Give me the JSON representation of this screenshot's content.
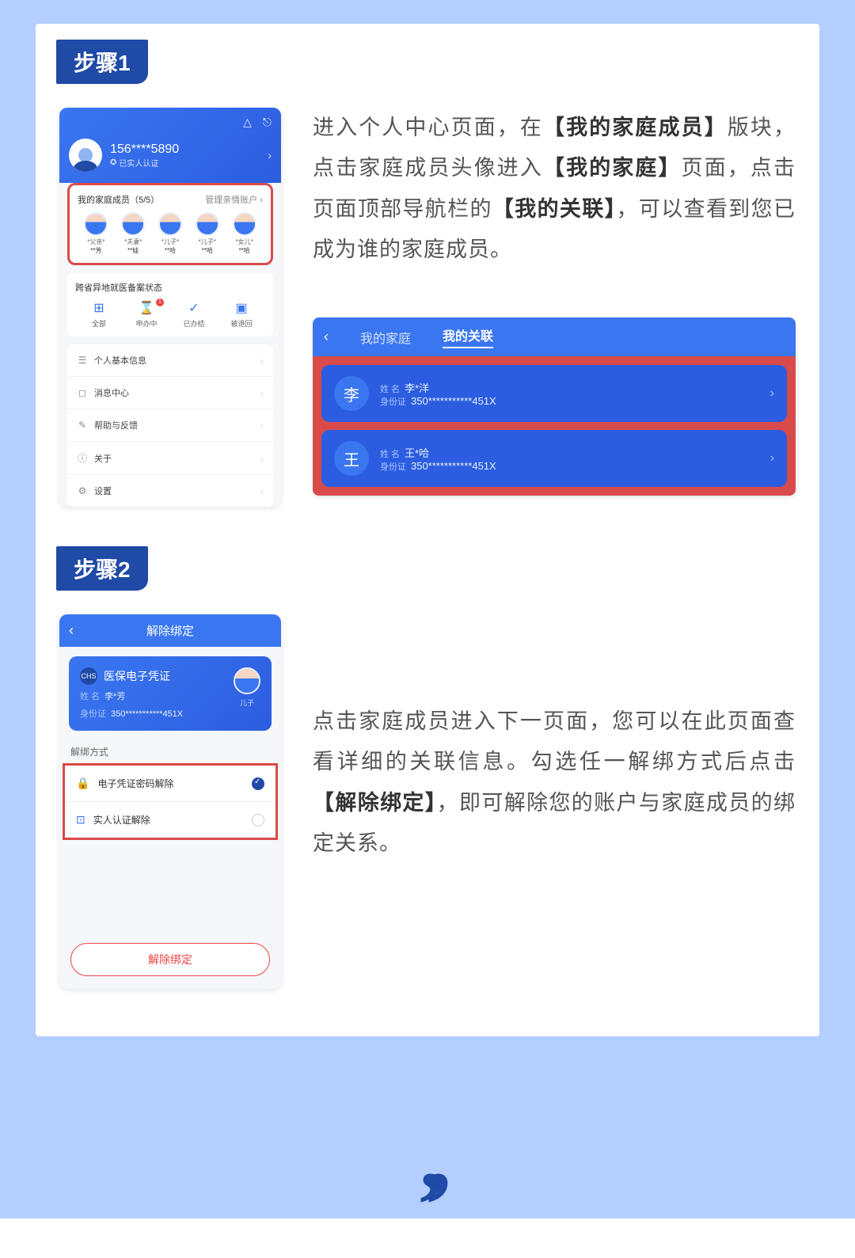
{
  "step1": {
    "badge": "步骤1",
    "desc_parts": {
      "p1": "进入个人中心页面，在",
      "b1": "【我的家庭成员】",
      "p2": "版块，点击家庭成员头像进入",
      "b2": "【我的家庭】",
      "p3": "页面，点击页面顶部导航栏的",
      "b3": "【我的关联】",
      "p4": "，可以查看到您已成为谁的家庭成员。"
    },
    "phone": {
      "user_name": "156****5890",
      "user_badge": "已实人认证",
      "family_title": "我的家庭成员（5/5）",
      "manage_label": "管理亲情账户",
      "members": [
        {
          "rel": "*父亲*",
          "name": "**芳"
        },
        {
          "rel": "*夫妻*",
          "name": "**娃"
        },
        {
          "rel": "*儿子*",
          "name": "**哈"
        },
        {
          "rel": "*儿子*",
          "name": "**哈"
        },
        {
          "rel": "*女儿*",
          "name": "**哈"
        }
      ],
      "status_title": "跨省异地就医备案状态",
      "statuses": [
        {
          "label": "全部"
        },
        {
          "label": "申办中",
          "dot": "1"
        },
        {
          "label": "已办结"
        },
        {
          "label": "被退回"
        }
      ],
      "menu": [
        {
          "icon": "☰",
          "label": "个人基本信息"
        },
        {
          "icon": "◻",
          "label": "消息中心"
        },
        {
          "icon": "✎",
          "label": "帮助与反馈"
        },
        {
          "icon": "ⓘ",
          "label": "关于"
        },
        {
          "icon": "⚙",
          "label": "设置"
        }
      ]
    },
    "mini": {
      "tab1": "我的家庭",
      "tab2": "我的关联",
      "items": [
        {
          "av": "李",
          "name_lbl": "姓 名",
          "name": "李*洋",
          "id_lbl": "身份证",
          "id": "350***********451X"
        },
        {
          "av": "王",
          "name_lbl": "姓 名",
          "name": "王*哈",
          "id_lbl": "身份证",
          "id": "350***********451X"
        }
      ]
    }
  },
  "step2": {
    "badge": "步骤2",
    "desc_parts": {
      "p1": "点击家庭成员进入下一页面，您可以在此页面查看详细的关联信息。勾选任一解绑方式后点击",
      "b1": "【解除绑定】",
      "p2": "，即可解除您的账户与家庭成员的绑定关系。"
    },
    "phone": {
      "title": "解除绑定",
      "ehc_title": "医保电子凭证",
      "logo_text": "CHS",
      "name_lbl": "姓 名",
      "name": "李*芳",
      "id_lbl": "身份证",
      "id": "350***********451X",
      "relation": "儿子",
      "unbind_section": "解绑方式",
      "options": [
        {
          "label": "电子凭证密码解除",
          "checked": true
        },
        {
          "label": "实人认证解除",
          "checked": false
        }
      ],
      "button": "解除绑定"
    }
  }
}
